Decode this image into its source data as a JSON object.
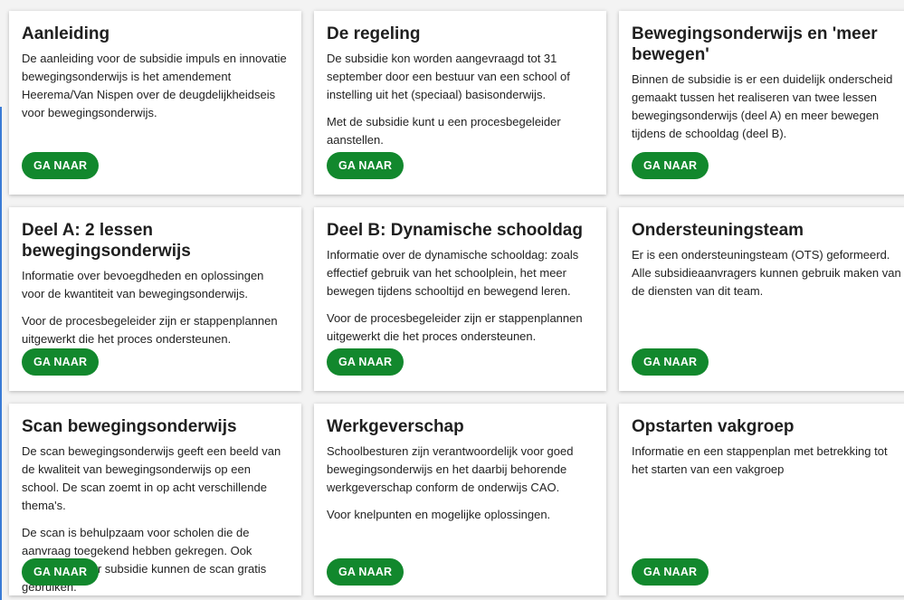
{
  "cards": [
    {
      "title": "Aanleiding",
      "paragraphs": [
        "De aanleiding voor de subsidie impuls en innovatie bewegingsonderwijs is het amendement Heerema/Van Nispen over de deugdelijkheidseis voor bewegingsonderwijs."
      ],
      "button": "GA NAAR"
    },
    {
      "title": "De regeling",
      "paragraphs": [
        "De subsidie kon worden aangevraagd tot 31 september door een bestuur van een school of instelling uit het (speciaal) basisonderwijs.",
        "Met de subsidie kunt u een procesbegeleider aanstellen."
      ],
      "button": "GA NAAR"
    },
    {
      "title": "Bewegingsonderwijs en 'meer bewegen'",
      "paragraphs": [
        "Binnen de subsidie is er een duidelijk onderscheid gemaakt tussen het realiseren van twee lessen bewegingsonderwijs (deel A) en meer bewegen tijdens de schooldag (deel B)."
      ],
      "button": "GA NAAR"
    },
    {
      "title": "Deel A: 2 lessen bewegingsonderwijs",
      "paragraphs": [
        "Informatie over bevoegdheden en oplossingen voor de kwantiteit van bewegingsonderwijs.",
        "Voor de procesbegeleider zijn er stappenplannen uitgewerkt die het proces ondersteunen."
      ],
      "button": "GA NAAR"
    },
    {
      "title": "Deel B: Dynamische schooldag",
      "paragraphs": [
        "Informatie over de dynamische schooldag: zoals effectief gebruik van het schoolplein, het meer bewegen tijdens schooltijd en bewegend leren.",
        "Voor de procesbegeleider zijn er stappenplannen uitgewerkt die het proces ondersteunen."
      ],
      "button": "GA NAAR"
    },
    {
      "title": "Ondersteuningsteam",
      "paragraphs": [
        "Er is een ondersteuningsteam (OTS) geformeerd. Alle subsidieaanvragers kunnen gebruik maken van de diensten van dit team."
      ],
      "button": "GA NAAR"
    },
    {
      "title": "Scan bewegingsonderwijs",
      "paragraphs": [
        "De scan bewegingsonderwijs geeft een beeld van de kwaliteit van bewegingsonderwijs op een school. De scan zoemt in op acht verschillende thema's.",
        "De scan is behulpzaam voor scholen die de aanvraag toegekend hebben gekregen. Ook scholen zonder subsidie kunnen de scan gratis gebruiken."
      ],
      "button": "GA NAAR"
    },
    {
      "title": "Werkgeverschap",
      "paragraphs": [
        "Schoolbesturen zijn verantwoordelijk voor goed bewegingsonderwijs en het daarbij behorende werkgeverschap conform de onderwijs CAO.",
        "Voor knelpunten en mogelijke oplossingen."
      ],
      "button": "GA NAAR"
    },
    {
      "title": "Opstarten vakgroep",
      "paragraphs": [
        "Informatie en een stappenplan met betrekking tot het starten van een vakgroep"
      ],
      "button": "GA NAAR"
    }
  ]
}
